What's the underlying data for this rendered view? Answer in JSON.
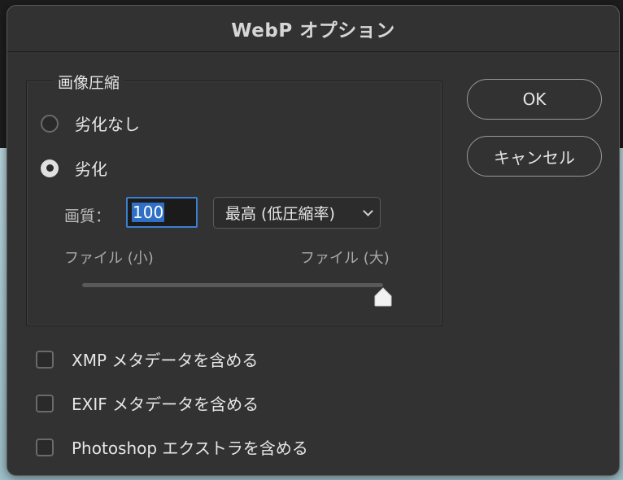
{
  "dialog": {
    "title": "WebP オプション"
  },
  "compression": {
    "group_label": "画像圧縮",
    "options": [
      {
        "label": "劣化なし",
        "selected": false
      },
      {
        "label": "劣化",
        "selected": true
      }
    ],
    "quality_label": "画質：",
    "quality_value": "100",
    "quality_preset": "最高 (低圧縮率)",
    "size_small_label": "ファイル (小)",
    "size_large_label": "ファイル (大)",
    "slider_value_percent": 100
  },
  "buttons": {
    "ok": "OK",
    "cancel": "キャンセル"
  },
  "checkboxes": [
    {
      "label": "XMP メタデータを含める",
      "checked": false
    },
    {
      "label": "EXIF メタデータを含める",
      "checked": false
    },
    {
      "label": "Photoshop エクストラを含める",
      "checked": false
    }
  ],
  "colors": {
    "accent": "#3c7fd0",
    "dialog_bg": "#323232"
  }
}
